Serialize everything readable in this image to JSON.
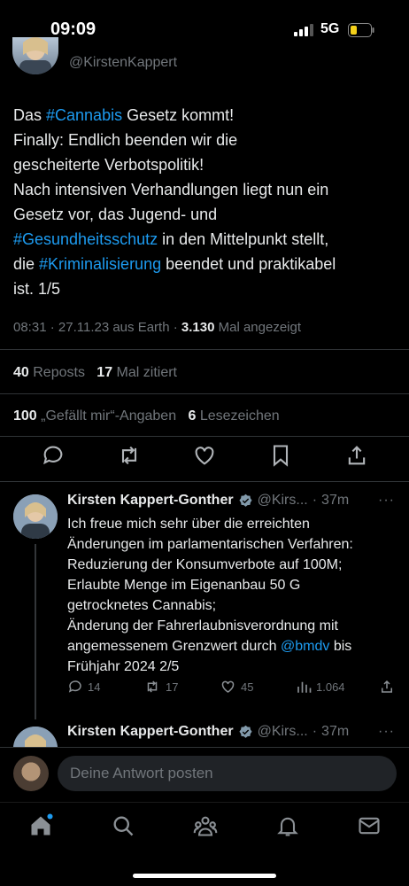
{
  "status_bar": {
    "time": "09:09",
    "network": "5G"
  },
  "tweet": {
    "handle": "@KirstenKappert",
    "body_segments": [
      {
        "text": "Das ",
        "link": false
      },
      {
        "text": "#Cannabis",
        "link": true
      },
      {
        "text": " Gesetz kommt!\nFinally: Endlich beenden wir die\ngescheiterte Verbotspolitik!\nNach intensiven Verhandlungen liegt nun ein\nGesetz vor, das Jugend- und\n",
        "link": false
      },
      {
        "text": "#Gesundheitsschutz",
        "link": true
      },
      {
        "text": " in den Mittelpunkt stellt,\ndie ",
        "link": false
      },
      {
        "text": "#Kriminalisierung",
        "link": true
      },
      {
        "text": " beendet und praktikabel\nist. 1/5",
        "link": false
      }
    ],
    "meta": {
      "time": "08:31",
      "date": "27.11.23",
      "source": "aus Earth",
      "views": "3.130",
      "views_label": "Mal angezeigt"
    },
    "reposts": "40",
    "reposts_label": "Reposts",
    "quotes": "17",
    "quotes_label": "Mal zitiert",
    "likes": "100",
    "likes_label": "„Gefällt mir“-Angaben",
    "bookmarks": "6",
    "bookmarks_label": "Lesezeichen"
  },
  "replies": [
    {
      "name": "Kirsten Kappert-Gonther",
      "handle": "@Kirs...",
      "time": "37m",
      "more": "···",
      "text_before_link": "Ich freue mich sehr über die erreichten\nÄnderungen im parlamentarischen Verfahren:\nReduzierung der Konsumverbote auf 100M;\nErlaubte Menge im Eigenanbau 50 G\ngetrocknetes Cannabis;\nÄnderung der Fahrerlaubnisverordnung mit\nangemessenem Grenzwert durch ",
      "link": "@bmdv",
      "text_after_link": " bis\nFrühjahr 2024   2/5",
      "replies": "14",
      "reposts": "17",
      "likes": "45",
      "views": "1.064"
    },
    {
      "name": "Kirsten Kappert-Gonther",
      "handle": "@Kirs...",
      "time": "37m",
      "more": "···"
    }
  ],
  "composer": {
    "placeholder": "Deine Antwort posten"
  },
  "colors": {
    "accent": "#1d9bf0",
    "muted": "#71767b",
    "text": "#e7e9ea",
    "background": "#000000"
  },
  "icons": {
    "actions": [
      "reply-icon",
      "repost-icon",
      "like-icon",
      "bookmark-icon",
      "share-icon"
    ],
    "tabs": [
      "home-icon",
      "search-icon",
      "communities-icon",
      "notifications-icon",
      "messages-icon"
    ]
  }
}
